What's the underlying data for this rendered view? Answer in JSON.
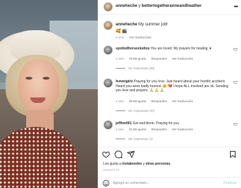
{
  "post": {
    "username": "anneheche",
    "separator": " y ",
    "collab": "bettertogetheranneandheather",
    "caption": "My summer job!",
    "caption_emojis": "🥰 🎬",
    "age": "4 sem",
    "translate": "Ver traducción"
  },
  "comments": [
    {
      "username": "spottedhorsestudios",
      "text": "You are loved. My prayers for healing. ♥",
      "age": "4 sem",
      "likes": "70 Me gusta",
      "reply": "Responder",
      "translate": "Ver traducción",
      "replies": "Ver respuestas (49)"
    },
    {
      "username": "femmigirlz",
      "text": "Praying for you love. Just heard about your horrific accident. Heard you were badly burned. 😢 💔 I hope ALL involved are ok. Sending you love and prayers. 🙏 🙏 🙏",
      "age": "4 sem",
      "likes": "30 Me gusta",
      "reply": "Responder",
      "translate": "Ver traducción",
      "replies": "Ver respuestas (20)"
    },
    {
      "username": "jeffhm001",
      "text": "Get well Anne. Praying for you",
      "age": "4 sem",
      "likes": "31 Me gusta",
      "reply": "Responder",
      "translate": "Ver traducción",
      "replies": "Ver respuestas (4)"
    }
  ],
  "likes_line": {
    "prefix": "Les gusta a ",
    "user": "instabeedee",
    "middle": " y ",
    "others": "otras personas"
  },
  "date": "AGOSTO 15",
  "add_comment": {
    "placeholder": "Agrega un comentario...",
    "post_label": "Publicar"
  }
}
